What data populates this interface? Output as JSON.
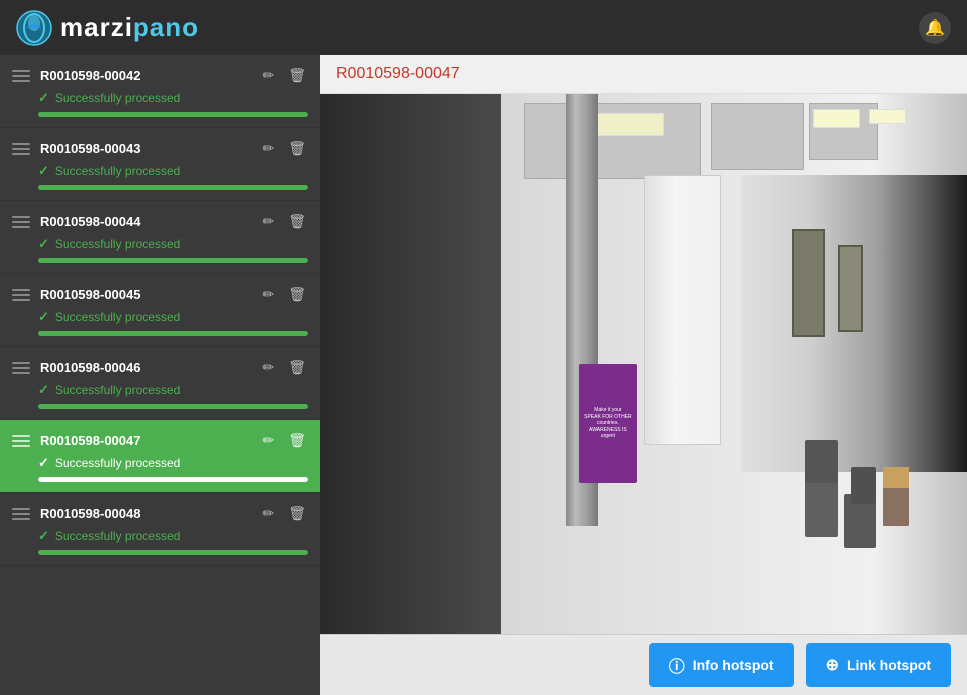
{
  "app": {
    "title": "marzipano",
    "logo_marzi": "marzi",
    "logo_pano": "pano"
  },
  "header": {
    "notification_icon": "🔔"
  },
  "sidebar": {
    "items": [
      {
        "id": "R0010598-00042",
        "name": "R0010598-00042",
        "status": "Successfully processed",
        "active": false
      },
      {
        "id": "R0010598-00043",
        "name": "R0010598-00043",
        "status": "Successfully processed",
        "active": false
      },
      {
        "id": "R0010598-00044",
        "name": "R0010598-00044",
        "status": "Successfully processed",
        "active": false
      },
      {
        "id": "R0010598-00045",
        "name": "R0010598-00045",
        "status": "Successfully processed",
        "active": false
      },
      {
        "id": "R0010598-00046",
        "name": "R0010598-00046",
        "status": "Successfully processed",
        "active": false
      },
      {
        "id": "R0010598-00047",
        "name": "R0010598-00047",
        "status": "Successfully processed",
        "active": true
      },
      {
        "id": "R0010598-00048",
        "name": "R0010598-00048",
        "status": "Successfully processed",
        "active": false
      }
    ]
  },
  "content": {
    "current_room": "R0010598-00047",
    "poster_text": "\"Make it your\nSPEAK FOR OTHER\ncountries.\nAWARENESS IS\nurgent\""
  },
  "footer": {
    "info_hotspot_label": "Info hotspot",
    "link_hotspot_label": "Link hotspot",
    "info_icon": "ⓘ",
    "link_icon": "⊕"
  }
}
